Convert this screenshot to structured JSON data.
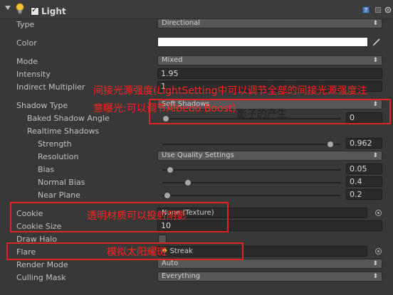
{
  "header": {
    "title": "Light"
  },
  "properties": {
    "type": {
      "label": "Type",
      "value": "Directional"
    },
    "color": {
      "label": "Color",
      "value": "#ffffff"
    },
    "mode": {
      "label": "Mode",
      "value": "Mixed"
    },
    "intensity": {
      "label": "Intensity",
      "value": "1.95"
    },
    "indirect": {
      "label": "Indirect Multiplier",
      "value": "1"
    },
    "shadow_type": {
      "label": "Shadow Type",
      "value": "Soft Shadows"
    },
    "baked_angle": {
      "label": "Baked Shadow Angle",
      "value": "0",
      "fraction": 0.0
    },
    "realtime_header": {
      "label": "Realtime Shadows"
    },
    "strength": {
      "label": "Strength",
      "value": "0.962",
      "fraction": 0.962
    },
    "resolution": {
      "label": "Resolution",
      "value": "Use Quality Settings"
    },
    "bias": {
      "label": "Bias",
      "value": "0.05",
      "fraction": 0.025
    },
    "normal_bias": {
      "label": "Normal Bias",
      "value": "0.4",
      "fraction": 0.13
    },
    "near_plane": {
      "label": "Near Plane",
      "value": "0.2",
      "fraction": 0.01
    },
    "cookie": {
      "label": "Cookie",
      "value": "None (Texture)"
    },
    "cookie_size": {
      "label": "Cookie Size",
      "value": "10"
    },
    "draw_halo": {
      "label": "Draw Halo",
      "checked": false
    },
    "flare": {
      "label": "Flare",
      "value": "Streak"
    },
    "render_mode": {
      "label": "Render Mode",
      "value": "Auto"
    },
    "culling_mask": {
      "label": "Culling Mask",
      "value": "Everything"
    }
  },
  "annotations": {
    "indirect_note_line1": "间接光源强度(LightSetting中可以调节全部的间接光源强度注",
    "indirect_note_line2": "意曝光:可以调节Albedo Boost)",
    "shadow_note": "影子的产生",
    "cookie_note": "透明材质可以投射阴影",
    "flare_note": "模拟太阳耀斑"
  },
  "colors": {
    "annotation_red": "#e02323",
    "panel_bg": "#383838"
  }
}
